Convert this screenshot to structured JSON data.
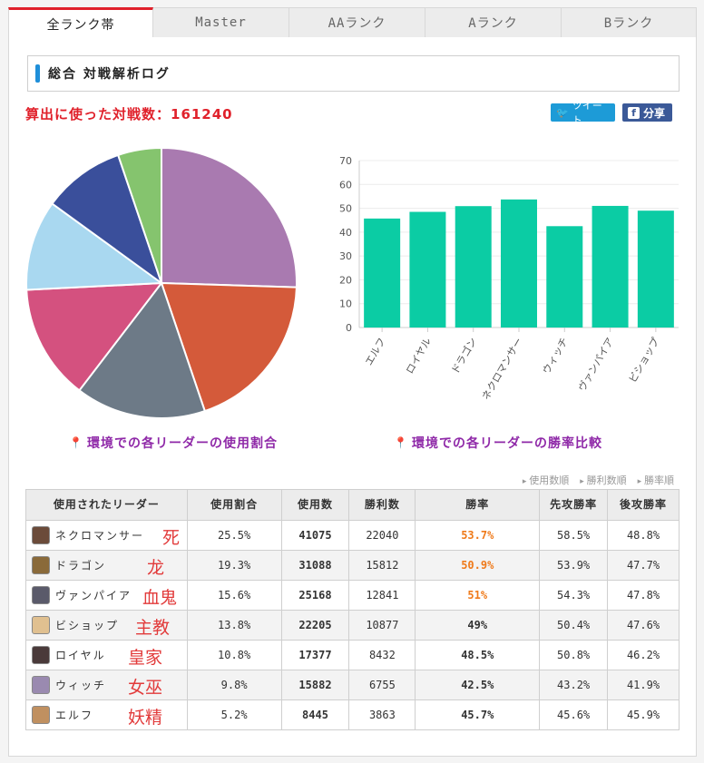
{
  "tabs": [
    {
      "label": "全ランク帯",
      "active": true
    },
    {
      "label": "Master",
      "active": false
    },
    {
      "label": "AAランク",
      "active": false
    },
    {
      "label": "Aランク",
      "active": false
    },
    {
      "label": "Bランク",
      "active": false
    }
  ],
  "heading": "総合 対戦解析ログ",
  "battle_count": "算出に使った対戦数：161240",
  "share": {
    "tweet": "ツイート",
    "fb": "分享"
  },
  "captions": {
    "pie": "環境での各リーダーの使用割合",
    "bar": "環境での各リーダーの勝率比較"
  },
  "sort_links": [
    "使用数順",
    "勝利数順",
    "勝率順"
  ],
  "table": {
    "headers": [
      "使用されたリーダー",
      "使用割合",
      "使用数",
      "勝利数",
      "勝率",
      "先攻勝率",
      "後攻勝率"
    ],
    "rows": [
      {
        "leader": "ネクロマンサー",
        "note": "死灵",
        "share": "25.5%",
        "uses": "41075",
        "wins": "22040",
        "winrate": "53.7%",
        "first": "58.5%",
        "second": "48.8%",
        "hot": true,
        "avatar": "#6b4b3a"
      },
      {
        "leader": "ドラゴン",
        "note": "龙",
        "share": "19.3%",
        "uses": "31088",
        "wins": "15812",
        "winrate": "50.9%",
        "first": "53.9%",
        "second": "47.7%",
        "hot": true,
        "avatar": "#8a6a3a"
      },
      {
        "leader": "ヴァンパイア",
        "note": "血鬼",
        "share": "15.6%",
        "uses": "25168",
        "wins": "12841",
        "winrate": "51%",
        "first": "54.3%",
        "second": "47.8%",
        "hot": true,
        "avatar": "#5a5a6a"
      },
      {
        "leader": "ビショップ",
        "note": "主教",
        "share": "13.8%",
        "uses": "22205",
        "wins": "10877",
        "winrate": "49%",
        "first": "50.4%",
        "second": "47.6%",
        "hot": false,
        "avatar": "#e0c090"
      },
      {
        "leader": "ロイヤル",
        "note": "皇家",
        "share": "10.8%",
        "uses": "17377",
        "wins": "8432",
        "winrate": "48.5%",
        "first": "50.8%",
        "second": "46.2%",
        "hot": false,
        "avatar": "#4a3a3a"
      },
      {
        "leader": "ウィッチ",
        "note": "女巫",
        "share": "9.8%",
        "uses": "15882",
        "wins": "6755",
        "winrate": "42.5%",
        "first": "43.2%",
        "second": "41.9%",
        "hot": false,
        "avatar": "#9a8ab0"
      },
      {
        "leader": "エルフ",
        "note": "妖精",
        "share": "5.2%",
        "uses": "8445",
        "wins": "3863",
        "winrate": "45.7%",
        "first": "45.6%",
        "second": "45.9%",
        "hot": false,
        "avatar": "#c09060"
      }
    ]
  },
  "chart_data": [
    {
      "type": "pie",
      "title": "",
      "slices": [
        {
          "label": "ネクロマンサー",
          "value": 25.5,
          "color": "#a97ab0"
        },
        {
          "label": "ドラゴン",
          "value": 19.3,
          "color": "#d45a3a"
        },
        {
          "label": "ヴァンパイア",
          "value": 15.6,
          "color": "#6d7a87"
        },
        {
          "label": "ビショップ",
          "value": 13.8,
          "color": "#d4517f"
        },
        {
          "label": "ロイヤル",
          "value": 10.8,
          "color": "#a9d8f0"
        },
        {
          "label": "ウィッチ",
          "value": 9.8,
          "color": "#3a4f9b"
        },
        {
          "label": "エルフ",
          "value": 5.2,
          "color": "#85c46e"
        }
      ]
    },
    {
      "type": "bar",
      "title": "",
      "categories": [
        "エルフ",
        "ロイヤル",
        "ドラゴン",
        "ネクロマンサー",
        "ウィッチ",
        "ヴァンパイア",
        "ビショップ"
      ],
      "values": [
        45.7,
        48.5,
        50.9,
        53.7,
        42.5,
        51,
        49
      ],
      "ylim": [
        0,
        70
      ],
      "yticks": [
        0,
        10,
        20,
        30,
        40,
        50,
        60,
        70
      ],
      "color": "#0bcca4",
      "grid": true
    }
  ]
}
